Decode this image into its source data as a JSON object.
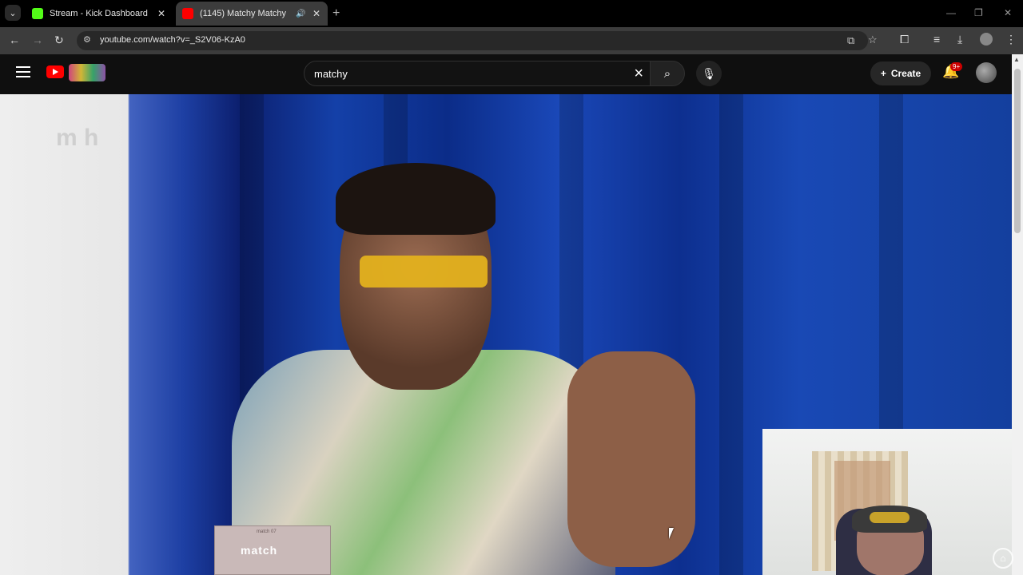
{
  "browser": {
    "tabs": [
      {
        "title": "Stream - Kick Dashboard",
        "favicon": "kick-icon",
        "color": "#53fc18"
      },
      {
        "title": "(1145) Matchy Matchy",
        "favicon": "youtube-icon",
        "color": "#ff0000"
      }
    ],
    "url": "youtube.com/watch?v=_S2V06-KzA0"
  },
  "youtube": {
    "search_value": "matchy",
    "create_label": "Create",
    "notification_badge": "9+"
  },
  "video": {
    "watermark": "m   h",
    "box_label": "match",
    "box_small_label": "match 07"
  }
}
